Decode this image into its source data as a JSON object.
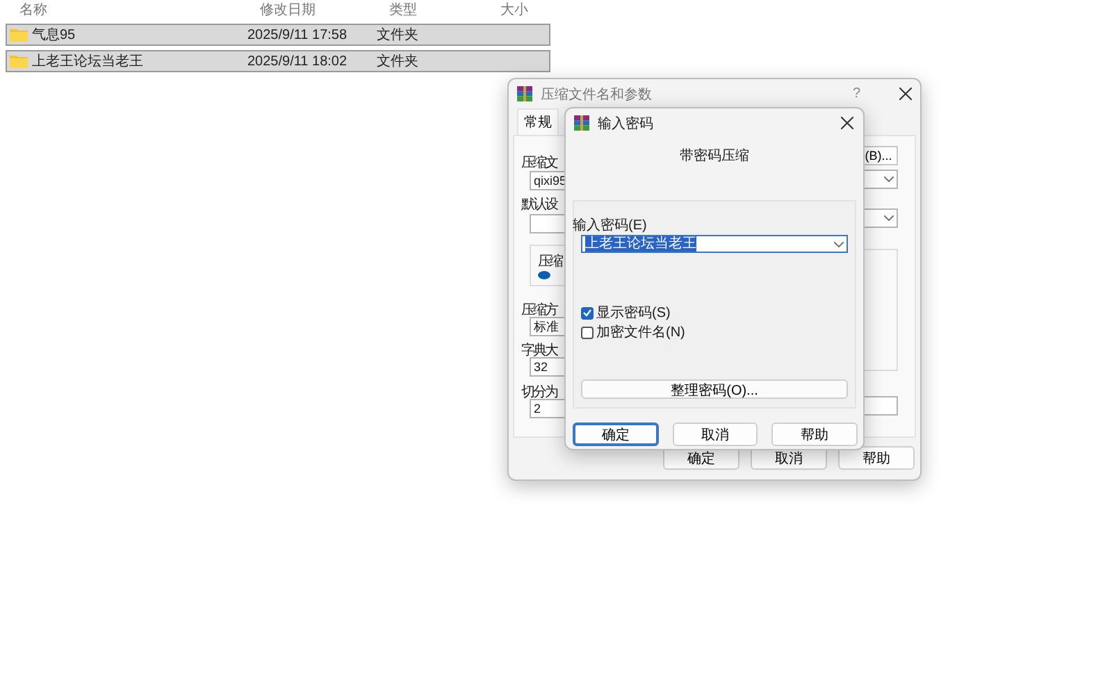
{
  "file_list": {
    "columns": [
      "名称",
      "修改日期",
      "类型",
      "大小"
    ],
    "rows": [
      {
        "name": "气息95",
        "modified": "2025/9/11 17:58",
        "type": "文件夹",
        "selected": true
      },
      {
        "name": "上老王论坛当老王",
        "modified": "2025/9/11 18:02",
        "type": "文件夹",
        "selected": true
      }
    ]
  },
  "archive_dialog": {
    "title": "压缩文件名和参数",
    "help": "?",
    "tabs": [
      {
        "label": "常规",
        "selected": true
      }
    ],
    "archive_name_label": "压缩文",
    "archive_name": "qixi95",
    "browse_button": "(B)...",
    "profile_label": "默认设",
    "group_label": "压缩",
    "radio_selected": true,
    "method_label": "压缩方",
    "method": "标准",
    "dictionary_label": "字典大",
    "dictionary": "32",
    "split_label": "切分为",
    "split": "2",
    "buttons": [
      "确定",
      "取消",
      "帮助"
    ]
  },
  "password_dialog": {
    "title": "输入密码",
    "heading": "带密码压缩",
    "password_label": "输入密码(E)",
    "password": "上老王论坛当老王",
    "options": [
      {
        "label": "显示密码(S)",
        "checked": true
      },
      {
        "label": "加密文件名(N)",
        "checked": false
      }
    ],
    "manage_button": "整理密码(O)...",
    "buttons": [
      {
        "label": "确定",
        "default": true
      },
      {
        "label": "取消",
        "default": false
      },
      {
        "label": "帮助",
        "default": false
      }
    ]
  }
}
